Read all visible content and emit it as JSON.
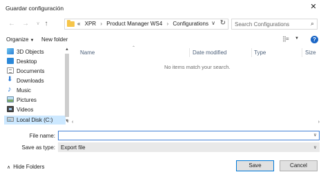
{
  "window": {
    "title": "Guardar configuración",
    "close_glyph": "✕"
  },
  "nav": {
    "back_glyph": "←",
    "forward_glyph": "→",
    "recent_glyph": "∨",
    "up_glyph": "↑",
    "breadcrumb_prefix": "«",
    "breadcrumb": [
      "XPR",
      "Product Manager WS4",
      "Configurations"
    ],
    "separator": "›",
    "dropdown_glyph": "∨",
    "refresh_glyph": "↻",
    "search_placeholder": "Search Configurations",
    "search_glyph": "⌕"
  },
  "toolbar": {
    "organize_label": "Organize",
    "new_folder_label": "New folder",
    "view_glyph": "⣿≡",
    "help_glyph": "?"
  },
  "sidebar": {
    "items": [
      {
        "label": "3D Objects",
        "icon": "3d-objects-icon"
      },
      {
        "label": "Desktop",
        "icon": "desktop-icon"
      },
      {
        "label": "Documents",
        "icon": "documents-icon"
      },
      {
        "label": "Downloads",
        "icon": "downloads-icon"
      },
      {
        "label": "Music",
        "icon": "music-icon"
      },
      {
        "label": "Pictures",
        "icon": "pictures-icon"
      },
      {
        "label": "Videos",
        "icon": "videos-icon"
      },
      {
        "label": "Local Disk (C:)",
        "icon": "local-disk-icon",
        "selected": true
      }
    ]
  },
  "file_list": {
    "columns": [
      "Name",
      "Date modified",
      "Type",
      "Size"
    ],
    "empty_message": "No items match your search."
  },
  "form": {
    "file_name_label": "File name:",
    "file_name_value": "",
    "save_as_type_label": "Save as type:",
    "save_as_type_value": "Export file"
  },
  "footer": {
    "hide_folders_label": "Hide Folders",
    "save_label": "Save",
    "cancel_label": "Cancel"
  },
  "colors": {
    "accent": "#0078d7",
    "selection": "#cce8ff",
    "column_header": "#4c607a",
    "folder": "#f6c54a"
  }
}
